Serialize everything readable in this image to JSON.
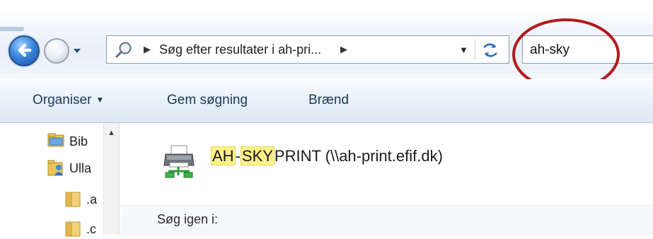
{
  "navbar": {
    "address_text": "Søg efter resultater i ah-pri...",
    "search_value": "ah-sky"
  },
  "commands": {
    "organise": "Organiser",
    "save_search": "Gem søgning",
    "burn": "Brænd"
  },
  "navpane": {
    "items": [
      {
        "label": "Bib",
        "icon": "libraries-icon"
      },
      {
        "label": "Ulla",
        "icon": "user-folder-icon"
      },
      {
        "label": ".a",
        "icon": "folder-icon"
      },
      {
        "label": ".c",
        "icon": "folder-icon"
      }
    ]
  },
  "results": {
    "item": {
      "highlight1": "AH",
      "dash": "-",
      "highlight2": "SKY",
      "rest": "PRINT (\\\\ah-print.efif.dk)",
      "icon": "network-printer-icon"
    },
    "search_again_label": "Søg igen i:"
  },
  "colors": {
    "annotation_circle": "#b3191c",
    "highlight": "#fdf28a",
    "command_text": "#1e395b"
  }
}
